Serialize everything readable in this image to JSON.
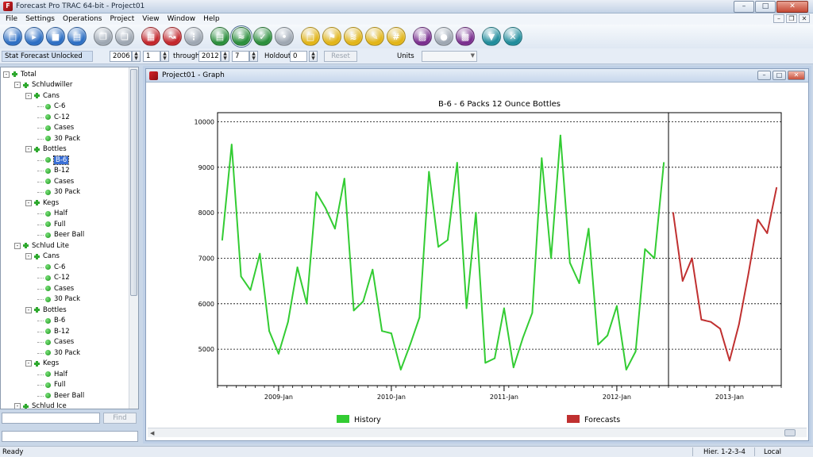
{
  "window": {
    "title": "Forecast Pro TRAC 64-bit - Project01"
  },
  "menu": [
    "File",
    "Settings",
    "Operations",
    "Project",
    "View",
    "Window",
    "Help"
  ],
  "toolbar": {
    "buttons": [
      {
        "name": "new-file",
        "color": "#2d6fc4"
      },
      {
        "name": "open-folder",
        "color": "#2d6fc4"
      },
      {
        "name": "save",
        "color": "#2d6fc4"
      },
      {
        "name": "print",
        "color": "#2d6fc4"
      },
      {
        "name": "copy",
        "color": "#9ea7b2"
      },
      {
        "name": "paste",
        "color": "#9ea7b2"
      },
      {
        "name": "data",
        "color": "#c4262b"
      },
      {
        "name": "chart-red",
        "color": "#c4262b"
      },
      {
        "name": "tools",
        "color": "#9ea7b2"
      },
      {
        "name": "report-green",
        "color": "#2b8f3b"
      },
      {
        "name": "graph-green",
        "color": "#2b8f3b",
        "active": true
      },
      {
        "name": "forecast-green",
        "color": "#2b8f3b"
      },
      {
        "name": "paw",
        "color": "#9ea7b2"
      },
      {
        "name": "yellow-doc",
        "color": "#e2b518"
      },
      {
        "name": "yellow-flag",
        "color": "#e2b518"
      },
      {
        "name": "yellow-chart",
        "color": "#e2b518"
      },
      {
        "name": "yellow-edit",
        "color": "#e2b518"
      },
      {
        "name": "yellow-hash",
        "color": "#e2b518"
      },
      {
        "name": "purple-1",
        "color": "#7a2f8f"
      },
      {
        "name": "purple-2",
        "color": "#9ea7b2"
      },
      {
        "name": "purple-3",
        "color": "#7a2f8f"
      },
      {
        "name": "teal-filter",
        "color": "#1f8c9b"
      },
      {
        "name": "teal-tools",
        "color": "#1f8c9b"
      }
    ]
  },
  "forecast_bar": {
    "status": "Stat Forecast Unlocked",
    "start_year": "2006",
    "start_period": "1",
    "through_label": "through",
    "end_year": "2012",
    "end_period": "7",
    "holdout_label": "Holdout",
    "holdout_value": "0",
    "reset_label": "Reset",
    "units_label": "Units",
    "units_value": ""
  },
  "tree": [
    {
      "label": "Total",
      "level": 0,
      "expandable": true
    },
    {
      "label": "Schludwiller",
      "level": 1,
      "expandable": true
    },
    {
      "label": "Cans",
      "level": 2,
      "expandable": true
    },
    {
      "label": "C-6",
      "level": 3
    },
    {
      "label": "C-12",
      "level": 3
    },
    {
      "label": "Cases",
      "level": 3
    },
    {
      "label": "30 Pack",
      "level": 3
    },
    {
      "label": "Bottles",
      "level": 2,
      "expandable": true
    },
    {
      "label": "B-6",
      "level": 3,
      "selected": true
    },
    {
      "label": "B-12",
      "level": 3
    },
    {
      "label": "Cases",
      "level": 3
    },
    {
      "label": "30 Pack",
      "level": 3
    },
    {
      "label": "Kegs",
      "level": 2,
      "expandable": true
    },
    {
      "label": "Half",
      "level": 3
    },
    {
      "label": "Full",
      "level": 3
    },
    {
      "label": "Beer Ball",
      "level": 3
    },
    {
      "label": "Schlud Lite",
      "level": 1,
      "expandable": true
    },
    {
      "label": "Cans",
      "level": 2,
      "expandable": true
    },
    {
      "label": "C-6",
      "level": 3
    },
    {
      "label": "C-12",
      "level": 3
    },
    {
      "label": "Cases",
      "level": 3
    },
    {
      "label": "30 Pack",
      "level": 3
    },
    {
      "label": "Bottles",
      "level": 2,
      "expandable": true
    },
    {
      "label": "B-6",
      "level": 3
    },
    {
      "label": "B-12",
      "level": 3
    },
    {
      "label": "Cases",
      "level": 3
    },
    {
      "label": "30 Pack",
      "level": 3
    },
    {
      "label": "Kegs",
      "level": 2,
      "expandable": true
    },
    {
      "label": "Half",
      "level": 3
    },
    {
      "label": "Full",
      "level": 3
    },
    {
      "label": "Beer Ball",
      "level": 3
    },
    {
      "label": "Schlud Ice",
      "level": 1,
      "expandable": true
    }
  ],
  "find": {
    "button_label": "Find",
    "value": ""
  },
  "graph_window": {
    "title": "Project01 - Graph"
  },
  "chart_data": {
    "type": "line",
    "title": "B-6 - 6 Packs 12 Ounce Bottles",
    "ylim": [
      4200,
      10200
    ],
    "yticks": [
      5000,
      6000,
      7000,
      8000,
      9000,
      10000
    ],
    "xlabels": [
      {
        "label": "2009-Jan",
        "index": 6
      },
      {
        "label": "2010-Jan",
        "index": 18
      },
      {
        "label": "2011-Jan",
        "index": 30
      },
      {
        "label": "2012-Jan",
        "index": 42
      },
      {
        "label": "2013-Jan",
        "index": 54
      }
    ],
    "x_count": 60,
    "forecast_divider_index": 47,
    "grid": "horizontal-dashed",
    "legend_position": "bottom",
    "series": [
      {
        "name": "History",
        "color": "#33cc33",
        "start_index": 0,
        "values": [
          7400,
          9500,
          6600,
          6300,
          7100,
          5400,
          4900,
          5600,
          6800,
          6000,
          8450,
          8100,
          7650,
          8750,
          5850,
          6050,
          6750,
          5400,
          5350,
          4550,
          5100,
          5700,
          8900,
          7250,
          7400,
          9100,
          5900,
          8000,
          4700,
          4800,
          5900,
          4600,
          5250,
          5800,
          9200,
          7000,
          9700,
          6900,
          6450,
          7650,
          5100,
          5300,
          5950,
          4550,
          4950,
          7200,
          7000,
          9100
        ]
      },
      {
        "name": "Forecasts",
        "color": "#c03030",
        "start_index": 48,
        "values": [
          8000,
          6500,
          7000,
          5650,
          5600,
          5450,
          4750,
          5550,
          6650,
          7850,
          7550,
          8550
        ]
      }
    ]
  },
  "statusbar": {
    "ready": "Ready",
    "hier": "Hier. 1-2-3-4",
    "local": "Local"
  }
}
